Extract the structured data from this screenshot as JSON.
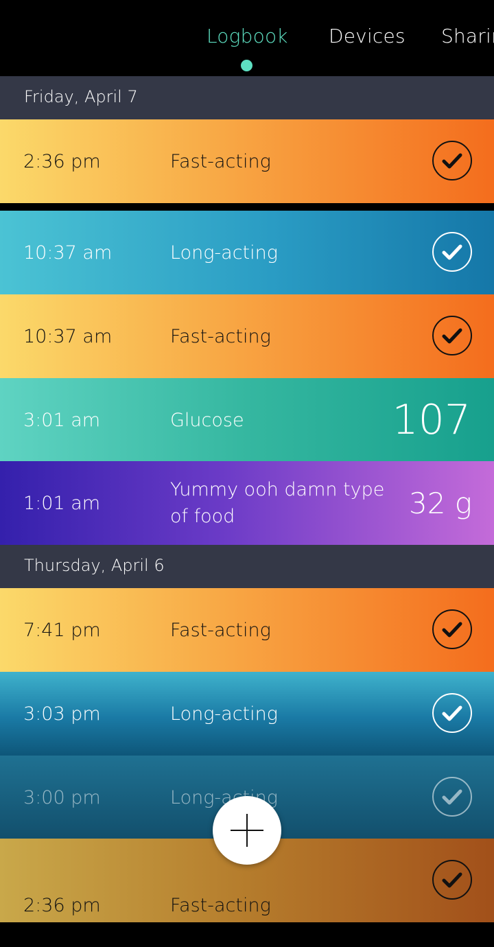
{
  "tabs": [
    {
      "label": "Logbook",
      "active": true
    },
    {
      "label": "Devices",
      "active": false
    },
    {
      "label": "Sharing",
      "active": false
    }
  ],
  "sections": [
    {
      "date": "Friday, April 7",
      "entries": [
        {
          "time": "2:36 pm",
          "label": "Fast-acting",
          "status": "checked"
        },
        {
          "time": "10:37 am",
          "label": "Long-acting",
          "status": "checked"
        },
        {
          "time": "10:37 am",
          "label": "Fast-acting",
          "status": "checked"
        },
        {
          "time": "3:01 am",
          "label": "Glucose",
          "value": "107"
        },
        {
          "time": "1:01 am",
          "label": "Yummy ooh damn type of food",
          "value": "32 g"
        }
      ]
    },
    {
      "date": "Thursday, April 6",
      "entries": [
        {
          "time": "7:41 pm",
          "label": "Fast-acting",
          "status": "checked"
        },
        {
          "time": "3:03 pm",
          "label": "Long-acting",
          "status": "checked"
        },
        {
          "time": "3:00 pm",
          "label": "Long-acting",
          "status": "checked"
        },
        {
          "time": "2:36 pm",
          "label": "Fast-acting",
          "status": "checked"
        }
      ]
    }
  ],
  "colors": {
    "accent": "#5ee0c2",
    "section_bg": "#343847",
    "fast_acting": "#f8a845",
    "long_acting": "#2a9cc4",
    "glucose": "#35b7a0",
    "food": "#6b3bc7"
  },
  "icons": {
    "check": "check-circle-icon",
    "add": "plus-icon"
  }
}
